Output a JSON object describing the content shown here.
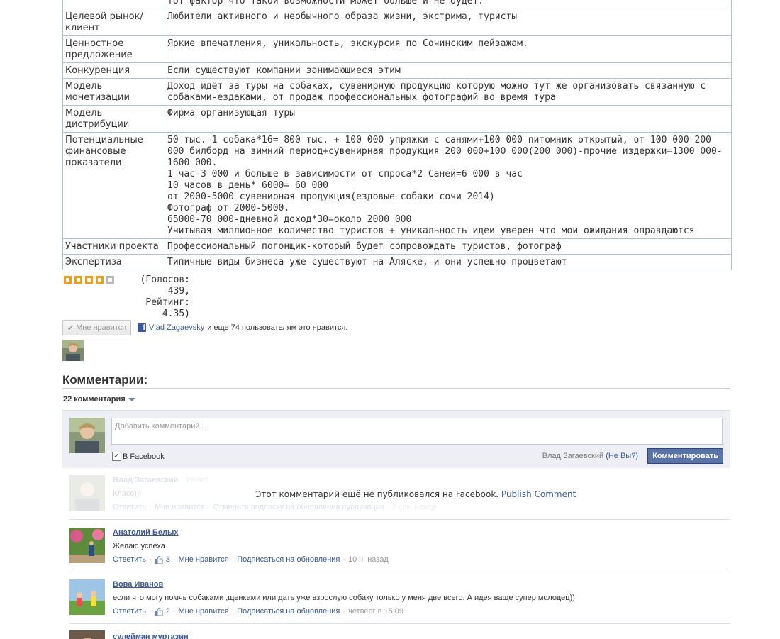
{
  "table": {
    "rows": [
      {
        "key": "",
        "value": "тот фактор что такой возможности может больше и не будет."
      },
      {
        "key": "Целевой рынок/ клиент",
        "value": "Любители активного и необычного образа жизни, экстрима, туристы"
      },
      {
        "key": "Ценностное предложение",
        "value": "Яркие впечатления, уникальность, экскурсия по Сочинским пейзажам."
      },
      {
        "key": "Конкуренция",
        "value": "Если существуют компании занимающиеся этим"
      },
      {
        "key": "Модель монетизации",
        "value": "Доход идёт за туры на собаках, сувенирную продукцию которую можно тут же организовать связанную с собаками-ездаками, от продаж профессиональных фотографий во время тура"
      },
      {
        "key": "Модель дистрибуции",
        "value": "Фирма организующая туры"
      },
      {
        "key": "Потенциальные финансовые показатели",
        "value": "50 тыс.-1 собака*16= 800 тыс. + 100 000 упряжки с санями+100 000 питомник открытый, от 100 000-200 000 билборд на зимний период+сувенирная продукция 200 000+100 000(200 000)-прочие издержки=1300 000-1600 000.\n1 час-3 000 и больше в зависимости от спроса*2 Саней=6 000 в час\n10 часов в день* 6000= 60 000\nот 2000-5000 сувенирная продукция(ездовые собаки сочи 2014)\nФотограф от 2000-5000.\n65000-70 000-дневной доход*30=около 2000 000\nУчитывая миллионное количество туристов + уникальность идеи уверен что мои ожидания оправдаются"
      },
      {
        "key": "Участники проекта",
        "value": "Профессиональный погонщик-который будет сопровождать туристов, фотограф"
      },
      {
        "key": "Экспертиза",
        "value": "Типичные виды бизнеса уже существуют на Аляске, и они успешно процветают"
      }
    ]
  },
  "rating": {
    "stars_filled": 4,
    "stars_total": 5,
    "votes_text": "(Голосов: 439, Рейтинг: 4.35)"
  },
  "like": {
    "button_label": "Мне нравится",
    "liker_name": "Vlad Zagaevsky",
    "liker_suffix": "и еще 74 пользователям это нравится."
  },
  "comments_section": {
    "title": "Комментарии:",
    "count_label": "22 комментария",
    "compose": {
      "placeholder": "Добавить комментарий...",
      "facebook_label": "В Facebook",
      "posting_as": "Влад Загаевский",
      "not_you": "(Не Вы?)",
      "submit_label": "Комментировать"
    },
    "pending": {
      "author": "Влад Загаевский",
      "time": "· 19 лет",
      "text": "Класс))!",
      "reply": "Ответить",
      "like": "Мне нравится",
      "unsubscribe": "Отменить подписку на обновления публикации",
      "ago": "· 2 сек. назад",
      "notice_text": "Этот комментарий ещё не публиковался на Facebook.",
      "notice_link": "Publish Comment"
    },
    "items": [
      {
        "author": "Анатолий Белых",
        "text": "Желаю успеха",
        "reply": "Ответить",
        "likes": "3",
        "like": "Мне нравится",
        "subscribe": "Подписаться на обновления",
        "time": "10 ч. назад"
      },
      {
        "author": "Вова Иванов",
        "text": "если что могу помчь собаками ,щенками или дать уже взрослую собаку только у меня две всего. А идея ваще супер молодец))",
        "reply": "Ответить",
        "likes": "2",
        "like": "Мне нравится",
        "subscribe": "Подписаться на обновления",
        "time": "четверг в 15:09"
      },
      {
        "author": "сулейман муртазин"
      }
    ]
  },
  "colors": {
    "fb_blue": "#3b5998",
    "star_on": "#f29d1a",
    "star_off": "#b8b8b8",
    "table_border": "#a9c3d8"
  }
}
